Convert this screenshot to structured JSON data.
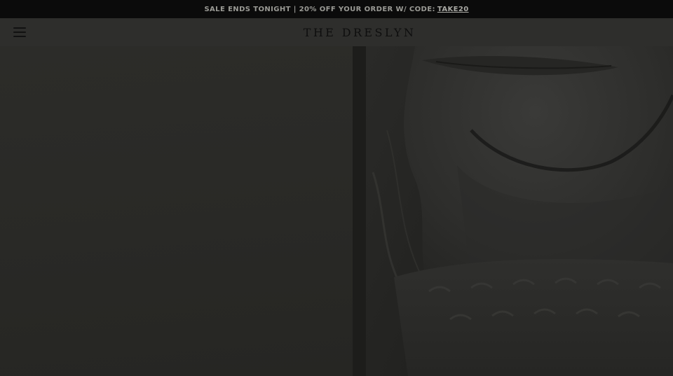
{
  "promo": {
    "text": "SALE ENDS TONIGHT | 20% OFF YOUR ORDER W/ CODE:",
    "code": "TAKE20"
  },
  "header": {
    "logo": "THE DRESLYN",
    "menu_icon": "hamburger-menu-icon"
  },
  "images": {
    "left": "product-image-left",
    "right": "model-portrait-image"
  },
  "colors": {
    "promo_bg": "#0b0b0b",
    "header_bg": "#2e2e2c",
    "overlay": "#1c1c1a"
  }
}
